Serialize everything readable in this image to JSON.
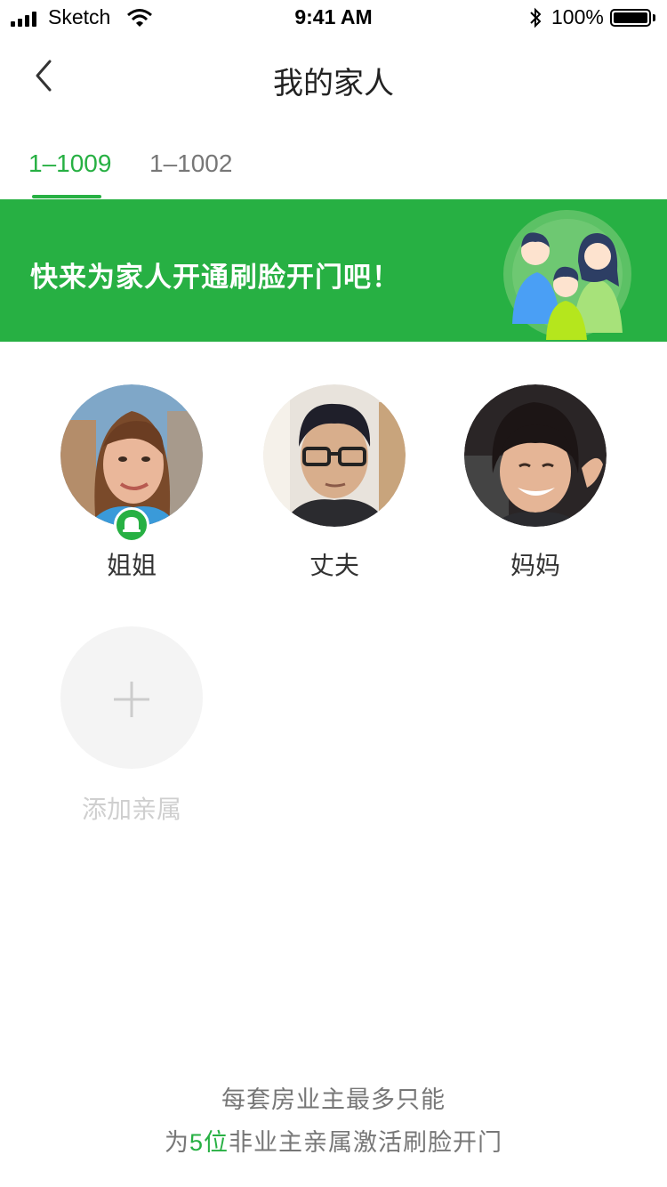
{
  "status_bar": {
    "carrier": "Sketch",
    "time": "9:41 AM",
    "battery": "100%"
  },
  "nav": {
    "title": "我的家人"
  },
  "tabs": [
    {
      "label": "1–1009",
      "active": true
    },
    {
      "label": "1–1002",
      "active": false
    }
  ],
  "banner": {
    "text": "快来为家人开通刷脸开门吧！"
  },
  "members": [
    {
      "name": "姐姐",
      "badge": "bell-icon"
    },
    {
      "name": "丈夫"
    },
    {
      "name": "妈妈"
    }
  ],
  "add": {
    "label": "添加亲属"
  },
  "footer": {
    "line1": "每套房业主最多只能",
    "line2_prefix": "为",
    "line2_highlight": "5位",
    "line2_suffix": "非业主亲属激活刷脸开门"
  },
  "colors": {
    "accent": "#27b043",
    "background": "#ffffff"
  }
}
